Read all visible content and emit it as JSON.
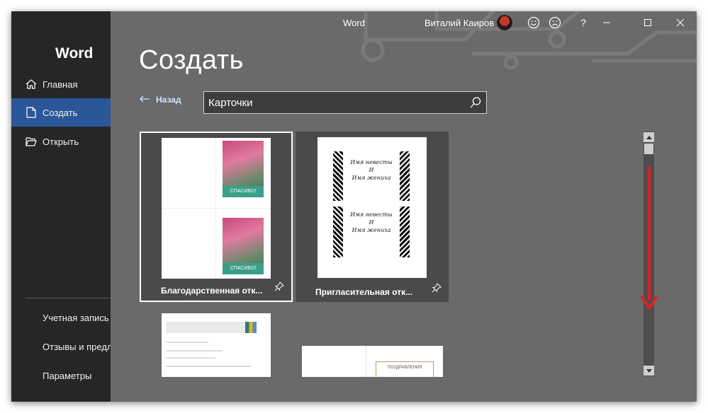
{
  "window": {
    "app_name": "Word",
    "user_name": "Виталий Каиров"
  },
  "sidebar": {
    "logo": "Word",
    "nav": [
      {
        "label": "Главная",
        "icon": "home-icon"
      },
      {
        "label": "Создать",
        "icon": "new-document-icon",
        "active": true
      },
      {
        "label": "Открыть",
        "icon": "open-folder-icon"
      }
    ],
    "bottom": [
      {
        "label": "Учетная запись"
      },
      {
        "label": "Отзывы и предло"
      },
      {
        "label": "Параметры"
      }
    ]
  },
  "main": {
    "title": "Создать",
    "back_label": "Назад",
    "search_value": "Карточки"
  },
  "templates": [
    {
      "title": "Благодарственная отк...",
      "thumb_text": "СПАСИБО!",
      "selected": true
    },
    {
      "title": "Пригласительная отк...",
      "thumb_lines": [
        "Имя невесты",
        "И",
        "Имя жениха"
      ]
    },
    {
      "thumb_text": "ПОЗДРАВЛЕНИЯ"
    }
  ],
  "colors": {
    "accent": "#2b579a",
    "sidebar_bg": "#262626",
    "window_bg": "#6a6a6a",
    "annotation": "#e02020"
  }
}
